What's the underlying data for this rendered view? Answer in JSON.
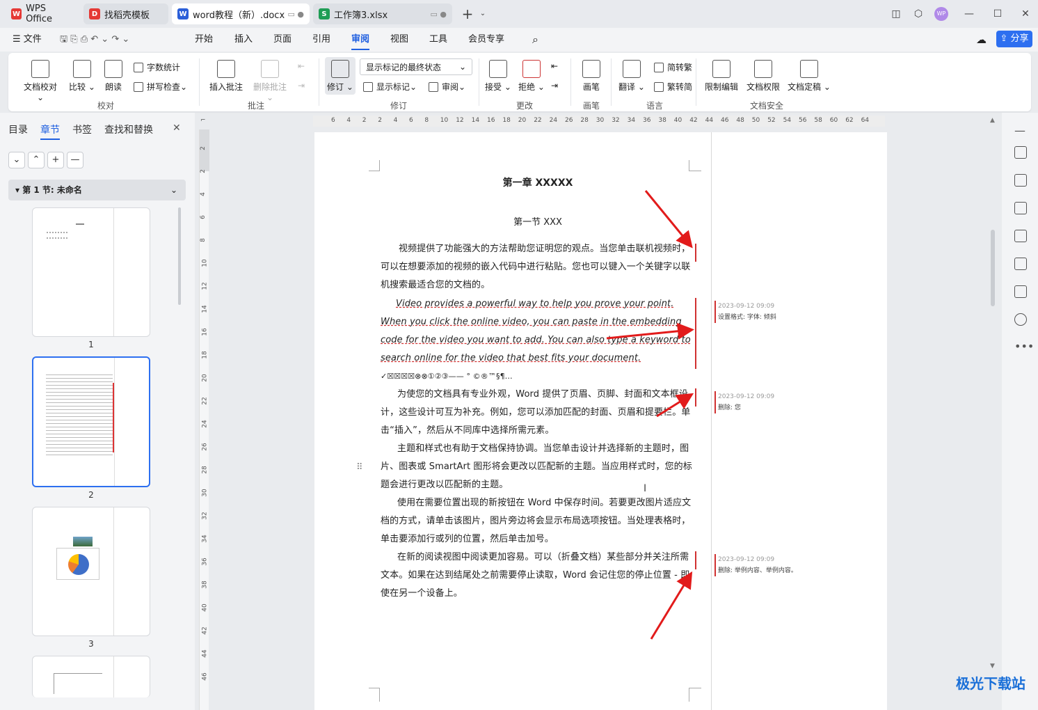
{
  "tabs": [
    {
      "label": "WPS Office",
      "icon": "W"
    },
    {
      "label": "找稻壳模板",
      "icon": "D"
    },
    {
      "label": "word教程（新）.docx",
      "icon": "W"
    },
    {
      "label": "工作簿3.xlsx",
      "icon": "S"
    }
  ],
  "menu": {
    "file": "文件",
    "items": [
      "开始",
      "插入",
      "页面",
      "引用",
      "审阅",
      "视图",
      "工具",
      "会员专享"
    ],
    "share": "分享"
  },
  "ribbon": {
    "proof": "文档校对",
    "compare": "比较",
    "read": "朗读",
    "wordcount": "字数统计",
    "spell": "拼写检查",
    "group_proof": "校对",
    "insert_comment": "插入批注",
    "delete_comment": "删除批注",
    "group_comment": "批注",
    "revise": "修订",
    "display_state": "显示标记的最终状态",
    "show_markup": "显示标记",
    "review": "审阅",
    "group_revise": "修订",
    "accept": "接受",
    "reject": "拒绝",
    "group_change": "更改",
    "pen": "画笔",
    "group_pen": "画笔",
    "translate": "翻译",
    "to_trad": "简转繁",
    "to_simp": "繁转简",
    "group_lang": "语言",
    "restrict": "限制编辑",
    "permission": "文档权限",
    "finalize": "文档定稿",
    "group_security": "文档安全"
  },
  "panel": {
    "tabs": [
      "目录",
      "章节",
      "书签",
      "查找和替换"
    ],
    "section": "第 1 节: 未命名",
    "pages": [
      "1",
      "2",
      "3"
    ]
  },
  "doc": {
    "title": "第一章  XXXXX",
    "subtitle": "第一节  XXX",
    "p1": "视频提供了功能强大的方法帮助您证明您的观点。当您单击联机视频时，可以在想要添加的视频的嵌入代码中进行粘贴。您也可以键入一个关键字以联机搜索最适合您的文档的。",
    "p2": "Video provides a powerful way to help you prove your point. When you click the online video, you can paste in the embedding code for the video you want to add. You can also type a keyword to search online for the video that best fits your document.",
    "symbols": "✓☒☒☒☒⊗⊗①②③——  °  ©®™§¶…",
    "p3": "为使您的文档具有专业外观，Word 提供了页眉、页脚、封面和文本框设计，这些设计可互为补充。例如，您可以添加匹配的封面、页眉和提要栏。单击“插入”，然后从不同库中选择所需元素。",
    "p4": "主题和样式也有助于文档保持协调。当您单击设计并选择新的主题时，图片、图表或 SmartArt 图形将会更改以匹配新的主题。当应用样式时，您的标题会进行更改以匹配新的主题。",
    "p5": "使用在需要位置出现的新按钮在 Word 中保存时间。若要更改图片适应文档的方式，请单击该图片，图片旁边将会显示布局选项按钮。当处理表格时，单击要添加行或列的位置，然后单击加号。",
    "p6": "在新的阅读视图中阅读更加容易。可以（折叠文档）某些部分并关注所需文本。如果在达到结尾处之前需要停止读取，Word 会记住您的停止位置 - 即使在另一个设备上。"
  },
  "comments": [
    {
      "time": "2023-09-12 09:09",
      "text": "设置格式: 字体: 倾斜"
    },
    {
      "time": "2023-09-12 09:09",
      "text": "删除: 您"
    },
    {
      "time": "2023-09-12 09:09",
      "text": "删除: 举例内容、举例内容。"
    }
  ],
  "hruler": [
    "6",
    "4",
    "2",
    "2",
    "4",
    "6",
    "8",
    "10",
    "12",
    "14",
    "16",
    "18",
    "20",
    "22",
    "24",
    "26",
    "28",
    "30",
    "32",
    "34",
    "36",
    "38",
    "40",
    "42",
    "44",
    "46",
    "48",
    "50",
    "52",
    "54",
    "56",
    "58",
    "60",
    "62",
    "64"
  ],
  "vruler": [
    "2",
    "2",
    "4",
    "6",
    "8",
    "10",
    "12",
    "14",
    "16",
    "18",
    "20",
    "22",
    "24",
    "26",
    "28",
    "30",
    "32",
    "34",
    "36",
    "38",
    "40",
    "42",
    "44",
    "46"
  ],
  "watermark": "极光下载站"
}
